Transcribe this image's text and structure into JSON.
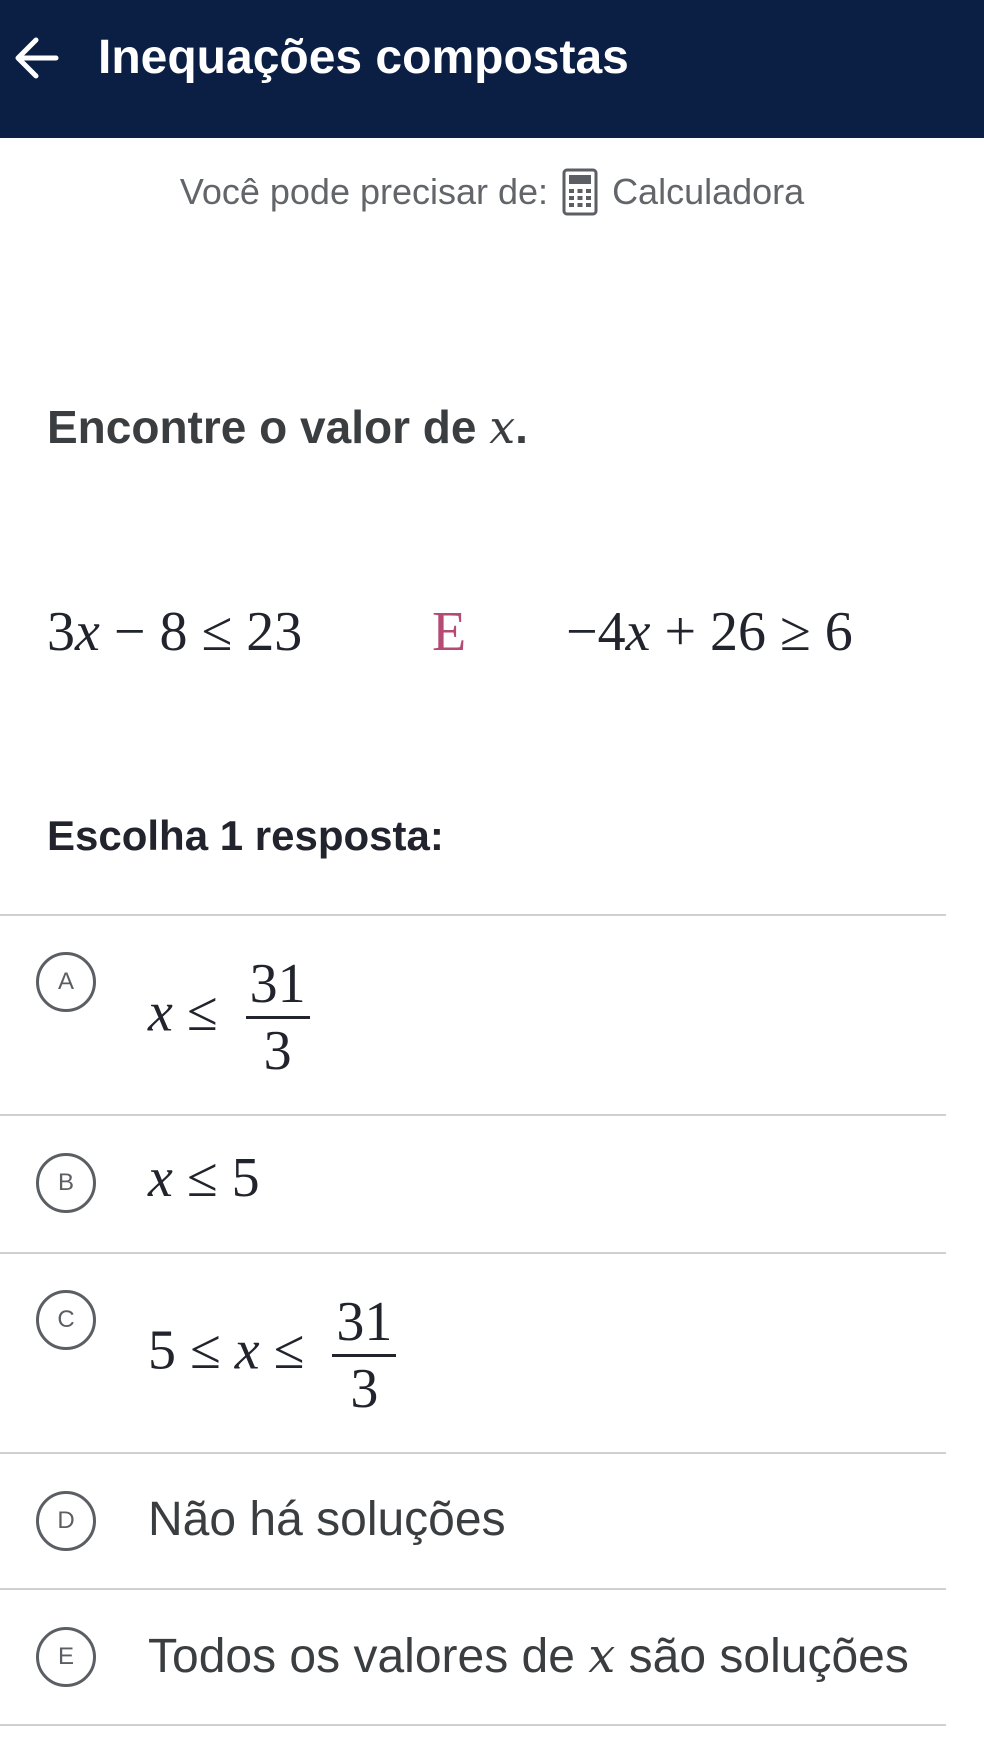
{
  "header": {
    "title": "Inequações compostas",
    "back_icon": "arrow-left-icon"
  },
  "hint": {
    "label": "Você pode precisar de:",
    "tool_label": "Calculadora",
    "tool_icon": "calculator-icon"
  },
  "question": {
    "text_prefix": "Encontre o valor de ",
    "variable": "x",
    "text_suffix": "."
  },
  "inequalities": {
    "first": {
      "coef": "3",
      "var": "x",
      "op": "−",
      "const": "8",
      "rel": "≤",
      "rhs": "23"
    },
    "conjunction": "E",
    "second": {
      "coef": "−4",
      "var": "x",
      "op": "+",
      "const": "26",
      "rel": "≥",
      "rhs": "6"
    }
  },
  "prompt": "Escolha 1 resposta:",
  "choices": [
    {
      "letter": "A",
      "var": "x",
      "rel": "≤",
      "num": "31",
      "den": "3"
    },
    {
      "letter": "B",
      "var": "x",
      "rel": "≤",
      "value": "5"
    },
    {
      "letter": "C",
      "lower": "5",
      "rel1": "≤",
      "var": "x",
      "rel2": "≤",
      "num": "31",
      "den": "3"
    },
    {
      "letter": "D",
      "text": "Não há soluções"
    },
    {
      "letter": "E",
      "text_prefix": "Todos os valores de ",
      "var": "x",
      "text_suffix": " são soluções"
    }
  ],
  "colors": {
    "header_bg": "#0b1f45",
    "conjunction": "#b54a72",
    "divider": "#cfd0d2"
  }
}
